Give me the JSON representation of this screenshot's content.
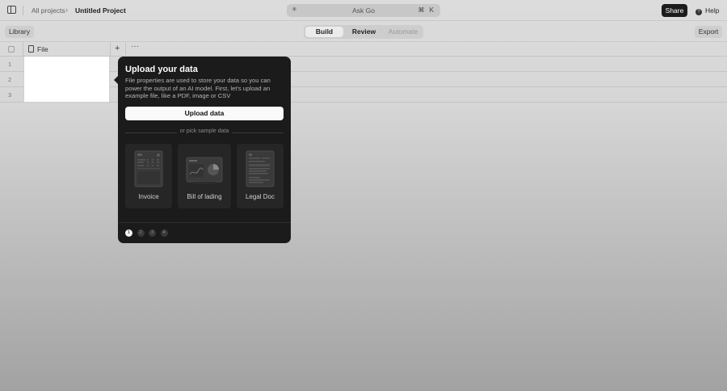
{
  "topbar": {
    "breadcrumb_parent": "All projects",
    "breadcrumb_separator": "›",
    "project_title": "Untitled Project",
    "ask_placeholder": "Ask Go",
    "ask_shortcut": "⌘ K",
    "share_label": "Share",
    "help_label": "Help"
  },
  "toolbar": {
    "library_label": "Library",
    "tabs": [
      {
        "label": "Build",
        "active": true
      },
      {
        "label": "Review",
        "active": false
      },
      {
        "label": "Automate",
        "active": false
      }
    ],
    "export_label": "Export"
  },
  "grid": {
    "column_header": "File",
    "add_column_symbol": "+",
    "more_symbol": "···",
    "rows": [
      "1",
      "2",
      "3"
    ]
  },
  "popover": {
    "title": "Upload your data",
    "description": "File properties are used to store your data so you can power the output of an AI model. First, let's upload an example file, like a PDF, image or CSV",
    "upload_label": "Upload data",
    "divider_label": "or pick sample data",
    "samples": [
      {
        "label": "Invoice",
        "icon": "invoice-thumbnail-icon"
      },
      {
        "label": "Bill of lading",
        "icon": "bill-of-lading-thumbnail-icon"
      },
      {
        "label": "Legal Doc",
        "icon": "legal-doc-thumbnail-icon"
      }
    ],
    "steps": [
      "1",
      "2",
      "3",
      "4"
    ],
    "active_step": 1
  },
  "colors": {
    "popover_bg": "#1b1b1b",
    "primary_button_bg": "#1c1c1c",
    "upload_button_bg": "#fafafa",
    "active_tab_bg": "#ebebeb"
  }
}
